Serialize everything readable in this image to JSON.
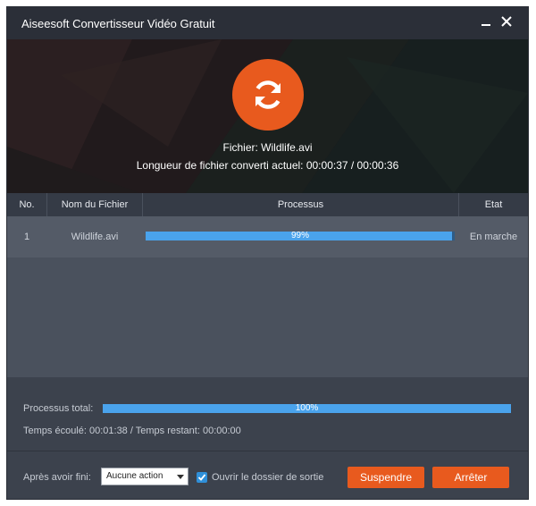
{
  "window": {
    "title": "Aiseesoft Convertisseur Vidéo Gratuit"
  },
  "icons": {
    "minimize": "minimize-icon",
    "close": "close-icon",
    "convert": "refresh-convert-icon",
    "checkbox": "checkmark-icon"
  },
  "colors": {
    "accent": "#e85a1e",
    "progress": "#4aa3ec",
    "background": "#434a56"
  },
  "status": {
    "file": "Fichier: Wildlife.avi",
    "length": "Longueur de fichier converti actuel: 00:00:37 / 00:00:36"
  },
  "table": {
    "headers": [
      "No.",
      "Nom du Fichier",
      "Processus",
      "Etat"
    ],
    "rows": [
      {
        "no": "1",
        "name": "Wildlife.avi",
        "progress": 0.99,
        "progress_label": "99%",
        "state": "En marche"
      }
    ]
  },
  "total": {
    "label": "Processus total:",
    "progress": 1.0,
    "progress_label": "100%",
    "time": "Temps écoulé: 00:01:38 / Temps restant: 00:00:00"
  },
  "after": {
    "label": "Après avoir fini:",
    "select_value": "Aucune action",
    "open_folder_checked": true,
    "open_folder_label": "Ouvrir le dossier de sortie"
  },
  "buttons": {
    "suspend": "Suspendre",
    "stop": "Arrêter"
  }
}
